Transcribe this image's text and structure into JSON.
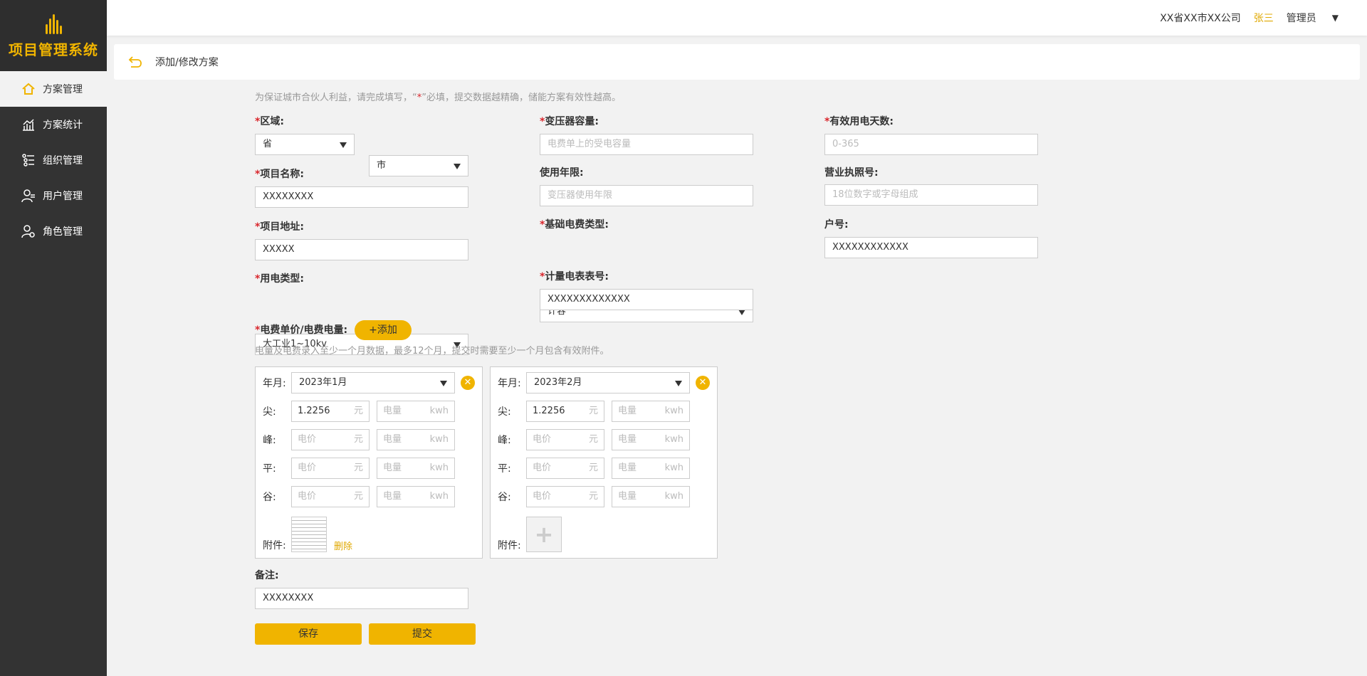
{
  "app": {
    "logo_text": "项目管理系统"
  },
  "sidebar": {
    "items": [
      {
        "label": "方案管理",
        "icon": "home-icon",
        "active": true
      },
      {
        "label": "方案统计",
        "icon": "chart-icon",
        "active": false
      },
      {
        "label": "组织管理",
        "icon": "org-icon",
        "active": false
      },
      {
        "label": "用户管理",
        "icon": "user-icon",
        "active": false
      },
      {
        "label": "角色管理",
        "icon": "role-icon",
        "active": false
      }
    ]
  },
  "topbar": {
    "company": "XX省XX市XX公司",
    "user": "张三",
    "role": "管理员",
    "caret": "▼"
  },
  "header": {
    "title": "添加/修改方案"
  },
  "form": {
    "hint_pre": "为保证城市合伙人利益，请完成填写，“",
    "hint_star": "*",
    "hint_post": "”必填，提交数据越精确，储能方案有效性越高。",
    "region": {
      "label": "区域:",
      "province": "省",
      "city": "市"
    },
    "project_name": {
      "label": "项目名称:",
      "value": "XXXXXXXX"
    },
    "project_address": {
      "label": "项目地址:",
      "value": "XXXXX"
    },
    "power_type": {
      "label": "用电类型:",
      "value": "大工业1~10kv"
    },
    "transformer": {
      "label": "变压器容量:",
      "placeholder": "电费单上的受电容量"
    },
    "years": {
      "label": "使用年限:",
      "placeholder": "变压器使用年限"
    },
    "base_fee": {
      "label": "基础电费类型:",
      "value": "计容"
    },
    "meter_no": {
      "label": "计量电表表号:",
      "value": "XXXXXXXXXXXXX"
    },
    "days": {
      "label": "有效用电天数:",
      "placeholder": "0-365"
    },
    "license": {
      "label": "营业执照号:",
      "placeholder": "18位数字或字母组成"
    },
    "account": {
      "label": "户号:",
      "value": "XXXXXXXXXXXX"
    },
    "price": {
      "label": "电费单价/电费电量:",
      "add_label": "+添加",
      "hint": "电量及电费录入至少一个月数据，最多12个月，提交时需要至少一个月包含有效附件。"
    },
    "month_label": "年月:",
    "periods": [
      "尖:",
      "峰:",
      "平:",
      "谷:"
    ],
    "price_placeholder": "电价",
    "price_unit": "元",
    "qty_placeholder": "电量",
    "qty_unit": "kwh",
    "attach_label": "附件:",
    "delete_label": "删除",
    "months": [
      {
        "month": "2023年1月",
        "prices": [
          "1.2256",
          "",
          "",
          ""
        ],
        "has_attachment": true
      },
      {
        "month": "2023年2月",
        "prices": [
          "1.2256",
          "",
          "",
          ""
        ],
        "has_attachment": false
      }
    ],
    "remark": {
      "label": "备注:",
      "value": "XXXXXXXX"
    },
    "save_label": "保存",
    "submit_label": "提交"
  },
  "colors": {
    "accent": "#f0b400",
    "sidebar": "#333333",
    "required": "#d9262c"
  }
}
